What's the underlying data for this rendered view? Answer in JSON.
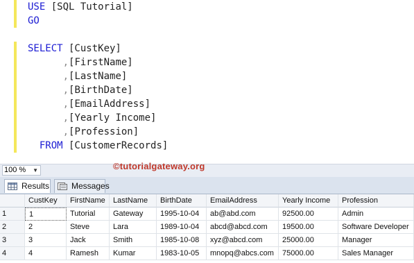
{
  "editor": {
    "lines": [
      {
        "kw": "USE",
        "rest": " [SQL Tutorial]"
      },
      {
        "kw": "GO",
        "rest": ""
      },
      {
        "kw": "",
        "rest": ""
      },
      {
        "kw": "SELECT",
        "rest": " [CustKey]"
      },
      {
        "indent": "      ",
        "comma": ",",
        "rest": "[FirstName]"
      },
      {
        "indent": "      ",
        "comma": ",",
        "rest": "[LastName]"
      },
      {
        "indent": "      ",
        "comma": ",",
        "rest": "[BirthDate]"
      },
      {
        "indent": "      ",
        "comma": ",",
        "rest": "[EmailAddress]"
      },
      {
        "indent": "      ",
        "comma": ",",
        "rest": "[Yearly Income]"
      },
      {
        "indent": "      ",
        "comma": ",",
        "rest": "[Profession]"
      },
      {
        "indent": "  ",
        "kw": "FROM",
        "rest": " [CustomerRecords]"
      }
    ]
  },
  "zoom": {
    "value": "100 %",
    "arrow": "▼"
  },
  "watermark": "©tutorialgateway.org",
  "tabs": {
    "results_label": "Results",
    "messages_label": "Messages"
  },
  "grid": {
    "columns": [
      "",
      "CustKey",
      "FirstName",
      "LastName",
      "BirthDate",
      "EmailAddress",
      "Yearly Income",
      "Profession"
    ],
    "rows": [
      [
        "1",
        "1",
        "Tutorial",
        "Gateway",
        "1995-10-04",
        "ab@abd.com",
        "92500.00",
        "Admin"
      ],
      [
        "2",
        "2",
        "Steve",
        "Lara",
        "1989-10-04",
        "abcd@abcd.com",
        "19500.00",
        "Software Developer"
      ],
      [
        "3",
        "3",
        "Jack",
        "Smith",
        "1985-10-08",
        "xyz@abcd.com",
        "25000.00",
        "Manager"
      ],
      [
        "4",
        "4",
        "Ramesh",
        "Kumar",
        "1983-10-05",
        "mnopq@abcs.com",
        "75000.00",
        "Sales Manager"
      ]
    ]
  },
  "colors": {
    "keyword": "#1b1bd3",
    "comma": "#8a8a8a",
    "change_bar": "#f4e75b",
    "watermark": "#c0392b"
  }
}
